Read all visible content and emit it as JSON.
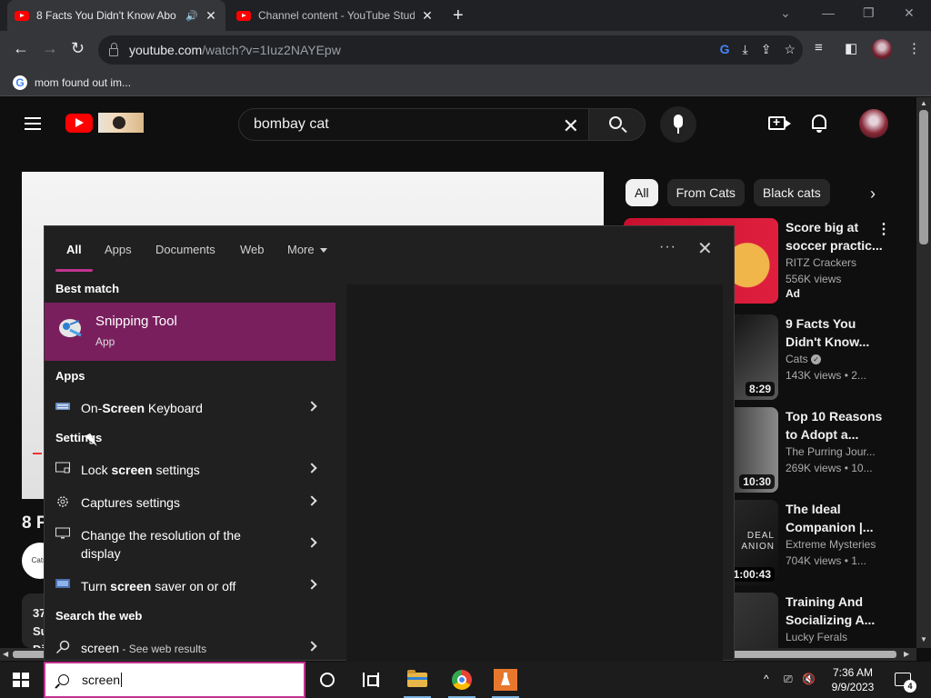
{
  "browser": {
    "tabs": [
      {
        "title": "8 Facts You Didn't Know Abo",
        "active": true,
        "audio": true
      },
      {
        "title": "Channel content - YouTube Studi",
        "active": false,
        "audio": false
      }
    ],
    "url_host": "youtube.com",
    "url_path": "/watch?v=1Iuz2NAYEpw",
    "bookmark": "mom found out im..."
  },
  "youtube": {
    "search_query": "bombay cat",
    "video_title_fragment": "8 F",
    "channel_avatar_text": "Cats.",
    "desc_fragment": "37\nSu\nDi",
    "chips": [
      "All",
      "From Cats",
      "Black cats"
    ],
    "recommendations": [
      {
        "title": "Score big at soccer practic...",
        "channel": "RITZ Crackers",
        "views": "556K views",
        "extra": "Ad",
        "duration": "",
        "verified": false
      },
      {
        "title": "9 Facts You Didn't Know...",
        "channel": "Cats",
        "views": "143K views",
        "extra": "• 2...",
        "duration": "8:29",
        "verified": true
      },
      {
        "title": "Top 10 Reasons to Adopt a...",
        "channel": "The Purring Jour...",
        "views": "269K views",
        "extra": "• 10...",
        "duration": "10:30",
        "verified": false
      },
      {
        "title": "The Ideal Companion |...",
        "channel": "Extreme Mysteries",
        "views": "704K views",
        "extra": "• 1...",
        "duration": "1:00:43",
        "verified": false
      },
      {
        "title": "Training And Socializing A...",
        "channel": "Lucky Ferals",
        "views": "",
        "extra": "",
        "duration": "",
        "verified": false
      }
    ],
    "thumb_overlay_text": "DEAL\nANION"
  },
  "start_search": {
    "tabs": [
      "All",
      "Apps",
      "Documents",
      "Web",
      "More"
    ],
    "best_match_heading": "Best match",
    "best_match": {
      "title": "Snipping Tool",
      "subtitle": "App"
    },
    "apps_heading": "Apps",
    "apps": [
      {
        "pre": "On-",
        "bold": "Screen",
        "post": " Keyboard"
      }
    ],
    "settings_heading": "Settings",
    "settings": [
      {
        "pre": "Lock ",
        "bold": "screen",
        "post": " settings"
      },
      {
        "pre": "Captures settings",
        "bold": "",
        "post": ""
      },
      {
        "pre": "Change the resolution of the display",
        "bold": "",
        "post": ""
      },
      {
        "pre": "Turn ",
        "bold": "screen",
        "post": " saver on or off"
      }
    ],
    "web_heading": "Search the web",
    "web": {
      "query": "screen",
      "suffix": " - See web results"
    }
  },
  "taskbar": {
    "search_text": "screen",
    "time": "7:36 AM",
    "date": "9/9/2023",
    "notification_count": "4"
  },
  "colors": {
    "accent": "#c2338f",
    "best_match_bg": "#7a1f5e",
    "youtube_red": "#ff0000"
  }
}
